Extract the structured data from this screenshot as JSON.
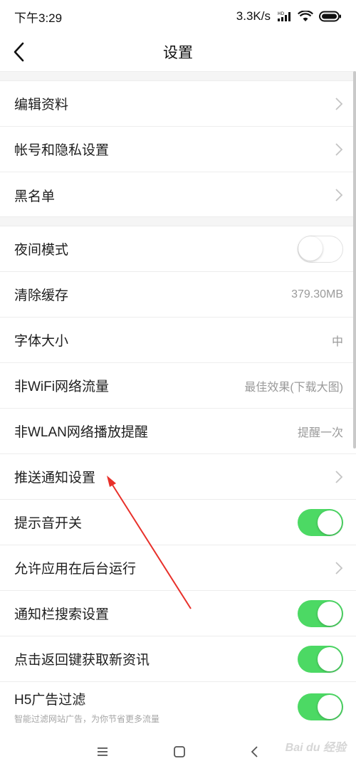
{
  "status": {
    "time": "下午3:29",
    "speed": "3.3K/s",
    "hd": "HD"
  },
  "header": {
    "title": "设置"
  },
  "group1": [
    {
      "label": "编辑资料"
    },
    {
      "label": "帐号和隐私设置"
    },
    {
      "label": "黑名单"
    }
  ],
  "group2": [
    {
      "label": "夜间模式",
      "toggle": "off"
    },
    {
      "label": "清除缓存",
      "value": "379.30MB"
    },
    {
      "label": "字体大小",
      "value": "中"
    },
    {
      "label": "非WiFi网络流量",
      "value": "最佳效果(下载大图)"
    },
    {
      "label": "非WLAN网络播放提醒",
      "value": "提醒一次"
    },
    {
      "label": "推送通知设置"
    },
    {
      "label": "提示音开关",
      "toggle": "on"
    },
    {
      "label": "允许应用在后台运行"
    },
    {
      "label": "通知栏搜索设置",
      "toggle": "on"
    },
    {
      "label": "点击返回键获取新资讯",
      "toggle": "on"
    },
    {
      "label": "H5广告过滤",
      "sub": "智能过滤网站广告，为你节省更多流量",
      "toggle": "on"
    }
  ],
  "colors": {
    "toggle_on": "#4cd964",
    "annotation_arrow": "#e8302a"
  },
  "watermark": "Bai du 经验"
}
